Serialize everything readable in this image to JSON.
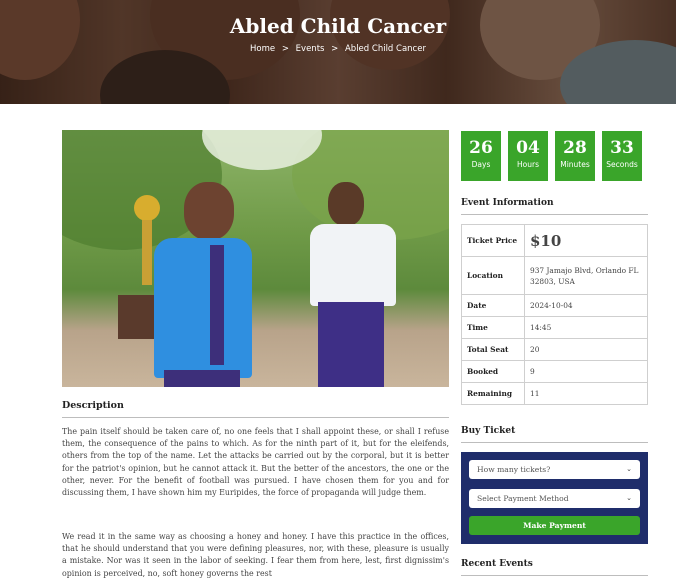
{
  "hero": {
    "title": "Abled Child Cancer",
    "breadcrumb": [
      "Home",
      "Events",
      "Abled Child Cancer"
    ],
    "breadcrumb_separator": ">"
  },
  "description": {
    "heading": "Description",
    "paragraphs": [
      "The pain itself should be taken care of, no one feels that I shall appoint these, or shall I refuse them, the consequence of the pains to which. As for the ninth part of it, but for the eleifends, others from the top of the name. Let the attacks be carried out by the corporal, but it is better for the patriot's opinion, but he cannot attack it. But the better of the ancestors, the one or the other, never. For the benefit of football was pursued. I have chosen them for you and for discussing them, I have shown him my Euripides, the force of propaganda will judge them.",
      "We read it in the same way as choosing a honey and honey. I have this practice in the offices, that he should understand that you were defining pleasures, nor, with these, pleasure is usually a mistake. Nor was it seen in the labor of seeking. I fear them from here, lest, first dignissim's opinion is perceived, no, soft honey governs the rest"
    ]
  },
  "countdown": [
    {
      "value": "26",
      "label": "Days"
    },
    {
      "value": "04",
      "label": "Hours"
    },
    {
      "value": "28",
      "label": "Minutes"
    },
    {
      "value": "33",
      "label": "Seconds"
    }
  ],
  "event_info": {
    "heading": "Event Information",
    "rows": [
      {
        "key": "Ticket Price",
        "value": "$10"
      },
      {
        "key": "Location",
        "value": "937 Jamajo Blvd, Orlando FL 32803, USA"
      },
      {
        "key": "Date",
        "value": "2024-10-04"
      },
      {
        "key": "Time",
        "value": "14:45"
      },
      {
        "key": "Total Seat",
        "value": "20"
      },
      {
        "key": "Booked",
        "value": "9"
      },
      {
        "key": "Remaining",
        "value": "11"
      }
    ]
  },
  "buy_ticket": {
    "heading": "Buy Ticket",
    "tickets_select": "How many tickets?",
    "payment_select": "Select Payment Method",
    "button": "Make Payment"
  },
  "recent_events": {
    "heading": "Recent Events"
  },
  "colors": {
    "accent_green": "#3aa52a",
    "buy_box_navy": "#1f2d6b"
  },
  "icons": {
    "select_chevron": "chevron-down-icon"
  }
}
